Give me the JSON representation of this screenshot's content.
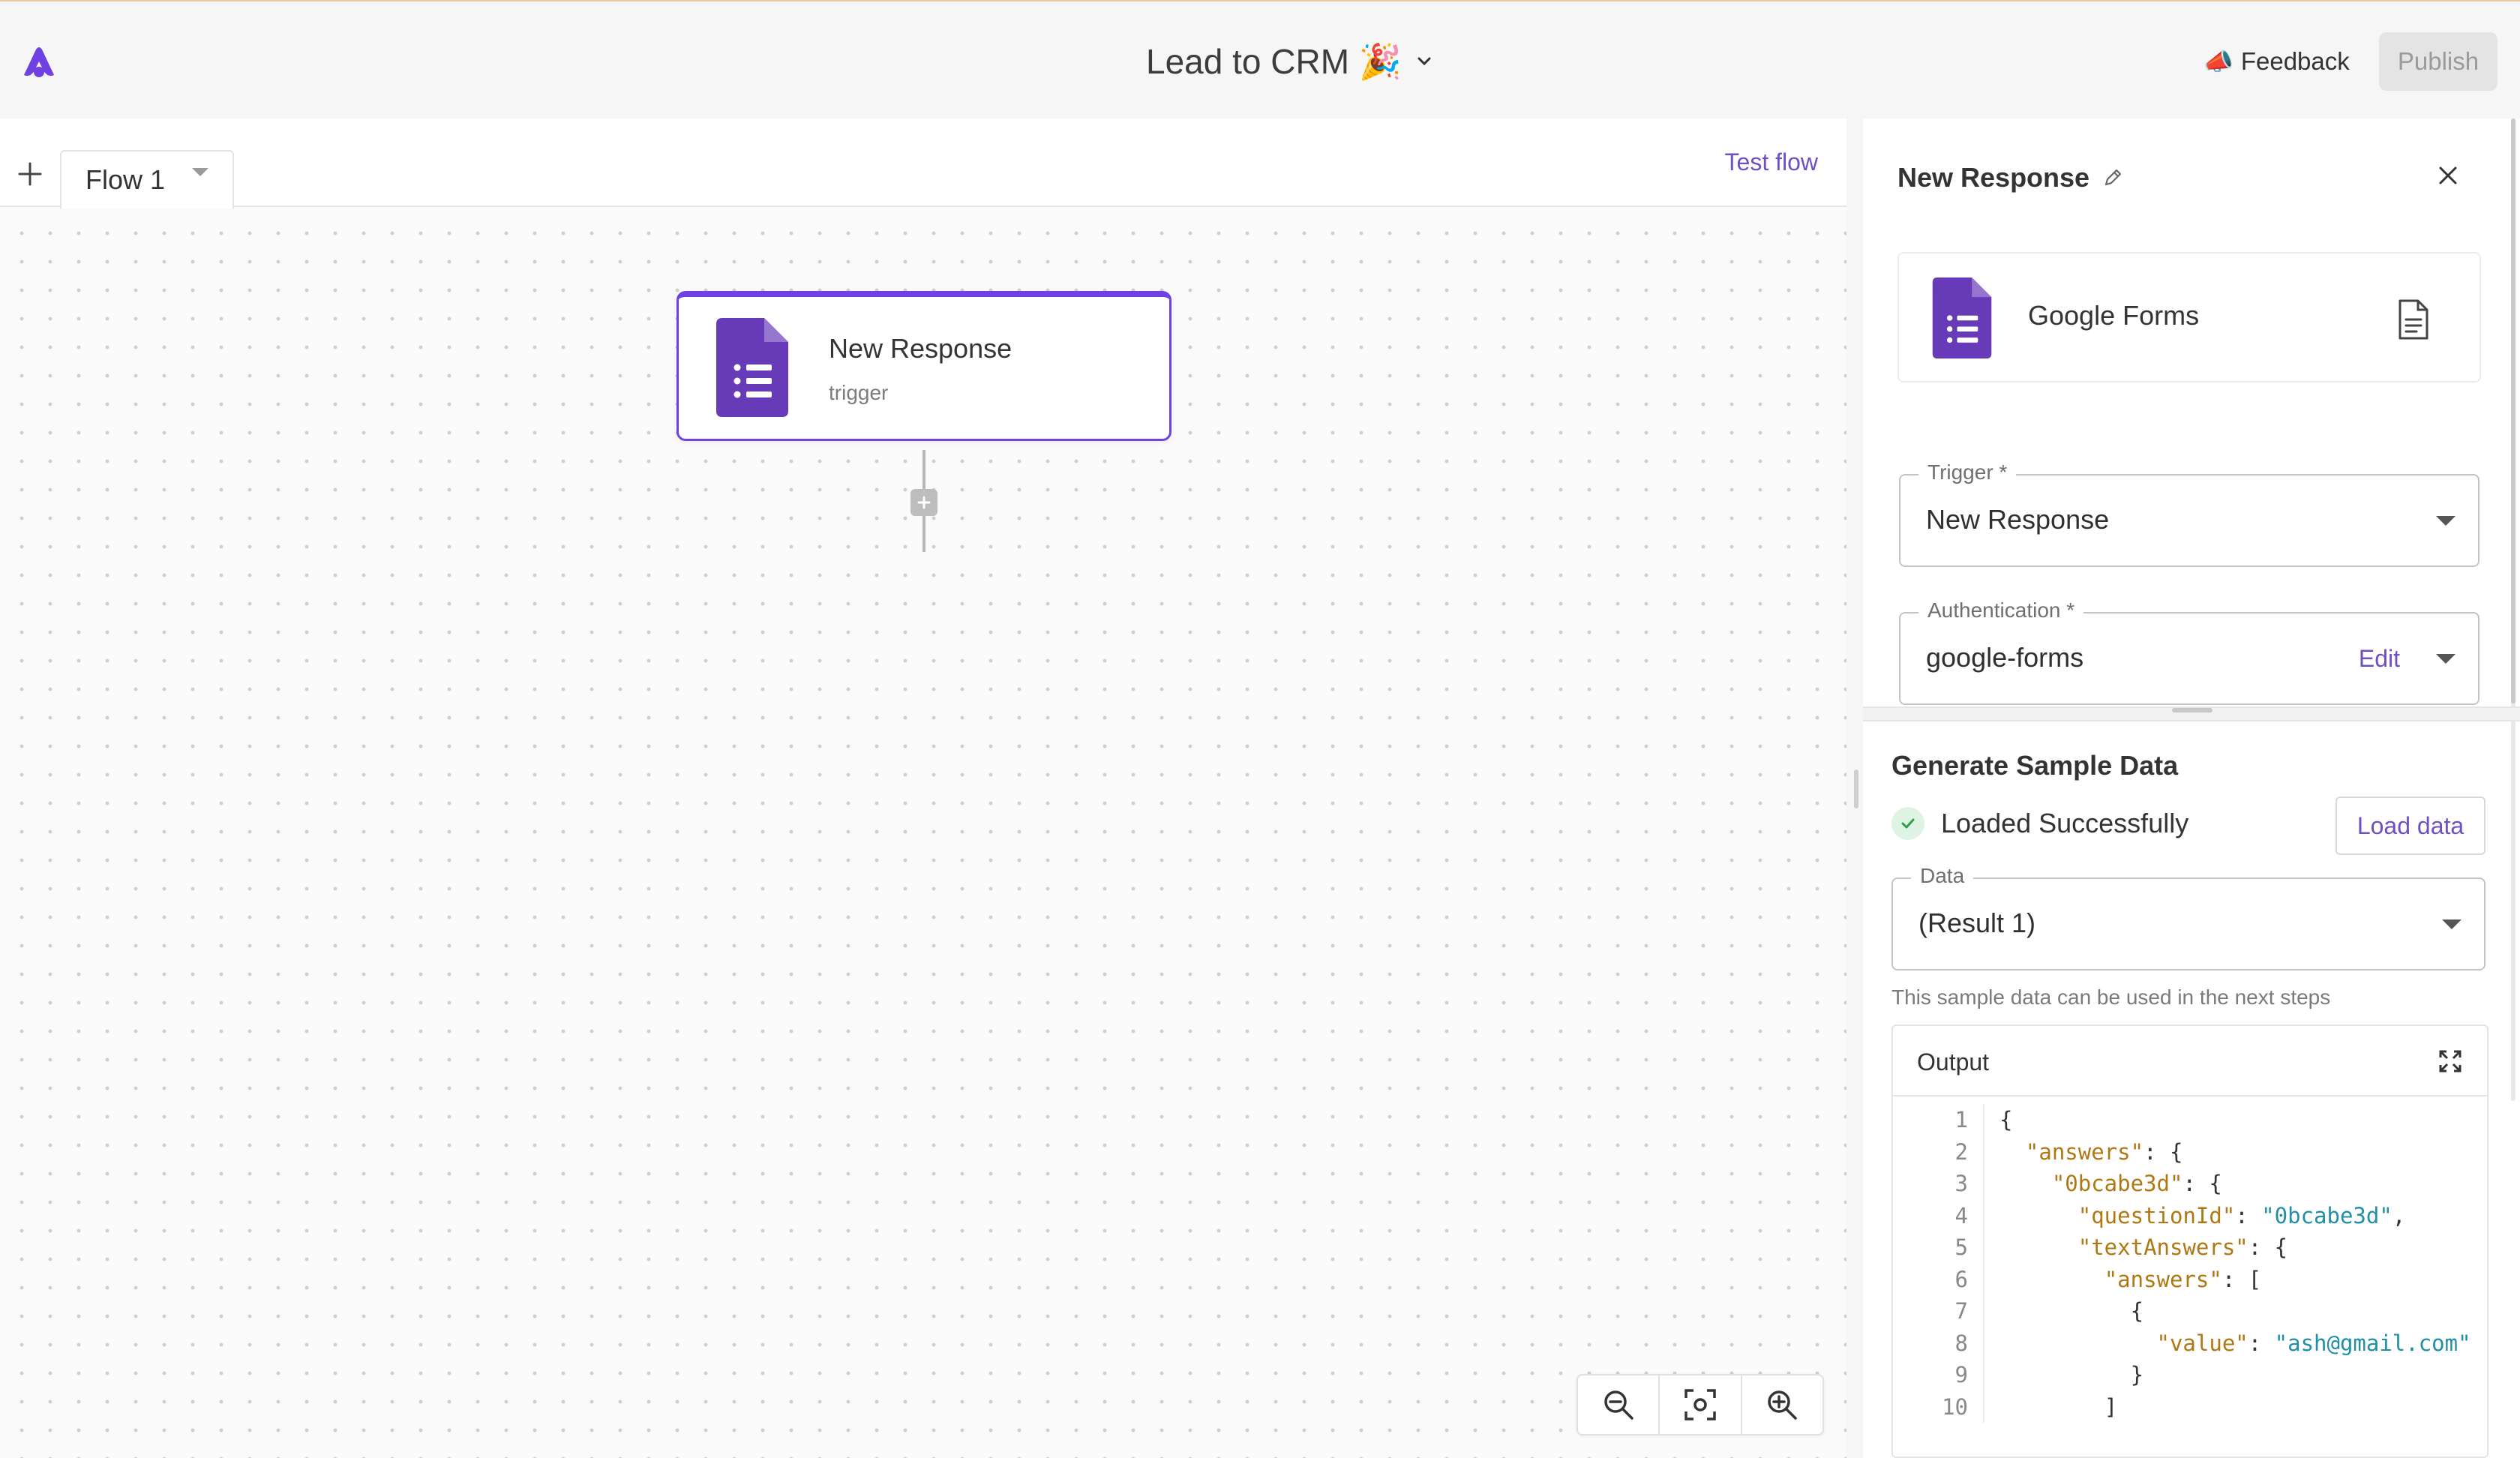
{
  "header": {
    "title": "Lead to CRM 🎉",
    "feedback_emoji": "📣",
    "feedback_label": "Feedback",
    "publish_label": "Publish"
  },
  "builder": {
    "tab_label": "Flow 1",
    "test_flow_label": "Test flow",
    "trigger_node": {
      "title": "New Response",
      "subtitle": "trigger",
      "icon": "google-forms-icon"
    }
  },
  "panel": {
    "step_title": "New Response",
    "app_name": "Google Forms",
    "trigger_field": {
      "label": "Trigger *",
      "value": "New Response"
    },
    "auth_field": {
      "label": "Authentication *",
      "value": "google-forms",
      "edit_label": "Edit"
    },
    "sample": {
      "section_title": "Generate Sample Data",
      "status": "Loaded Successfully",
      "load_button": "Load data",
      "data_label": "Data",
      "data_value": "(Result 1)",
      "hint": "This sample data can be used in the next steps",
      "output_title": "Output"
    },
    "code_lines": [
      {
        "n": "1",
        "indent": "",
        "key": "",
        "sep": "",
        "val": "",
        "tail": "{"
      },
      {
        "n": "2",
        "indent": "  ",
        "key": "\"answers\"",
        "sep": ": ",
        "val": "",
        "tail": "{"
      },
      {
        "n": "3",
        "indent": "    ",
        "key": "\"0bcabe3d\"",
        "sep": ": ",
        "val": "",
        "tail": "{"
      },
      {
        "n": "4",
        "indent": "      ",
        "key": "\"questionId\"",
        "sep": ": ",
        "val": "\"0bcabe3d\"",
        "tail": ","
      },
      {
        "n": "5",
        "indent": "      ",
        "key": "\"textAnswers\"",
        "sep": ": ",
        "val": "",
        "tail": "{"
      },
      {
        "n": "6",
        "indent": "        ",
        "key": "\"answers\"",
        "sep": ": ",
        "val": "",
        "tail": "["
      },
      {
        "n": "7",
        "indent": "          ",
        "key": "",
        "sep": "",
        "val": "",
        "tail": "{"
      },
      {
        "n": "8",
        "indent": "            ",
        "key": "\"value\"",
        "sep": ": ",
        "val": "\"ash@gmail.com\"",
        "tail": ""
      },
      {
        "n": "9",
        "indent": "          ",
        "key": "",
        "sep": "",
        "val": "",
        "tail": "}"
      },
      {
        "n": "10",
        "indent": "        ",
        "key": "",
        "sep": "",
        "val": "",
        "tail": "]"
      }
    ]
  },
  "colors": {
    "accent": "#6e41e2",
    "forms_purple": "#673ab7",
    "link": "#6e4fc4",
    "success": "#2e9e47"
  }
}
